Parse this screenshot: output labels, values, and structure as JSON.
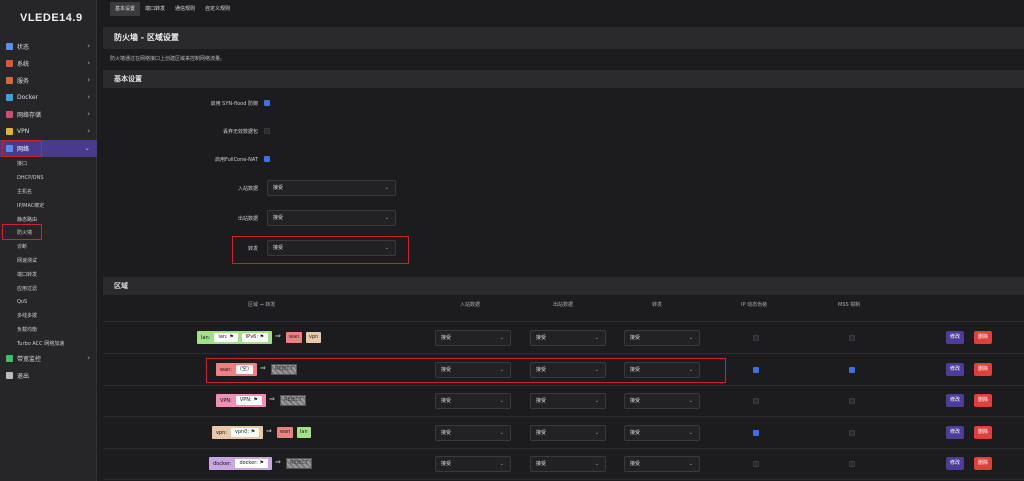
{
  "brand": "VLEDE14.9",
  "menu": [
    {
      "label": "状态",
      "color": "#5b8def"
    },
    {
      "label": "系统",
      "color": "#e0553a"
    },
    {
      "label": "服务",
      "color": "#d46a3a"
    },
    {
      "label": "Docker",
      "color": "#3ba3e0"
    },
    {
      "label": "网络存储",
      "color": "#c8506a"
    },
    {
      "label": "VPN",
      "color": "#e0b23a"
    },
    {
      "label": "网络",
      "color": "#5b8def"
    }
  ],
  "submenu": [
    "接口",
    "DHCP/DNS",
    "主机名",
    "IP/MAC绑定",
    "静态路由",
    "防火墙",
    "诊断",
    "网速测试",
    "端口转发",
    "应用过滤",
    "QoS",
    "多线多拨",
    "负载均衡",
    "Turbo ACC 网络加速"
  ],
  "menu_bottom": [
    {
      "label": "带宽监控",
      "color": "#3fbf6a"
    },
    {
      "label": "退出",
      "color": "#bbb"
    }
  ],
  "tabs": [
    "基本设置",
    "端口转发",
    "通信规则",
    "自定义规则"
  ],
  "title": "防火墙 - 区域设置",
  "description": "防火墙通过在网络接口上创建区域来控制网络流量。",
  "basic": {
    "header": "基本设置",
    "synflood": "启用 SYN-flood 防御",
    "drop_invalid": "丢弃无效数据包",
    "fullcone": "启用FullCone-NAT",
    "input_label": "入站数据",
    "input_value": "接受",
    "output_label": "出站数据",
    "output_value": "接受",
    "forward_label": "转发",
    "forward_value": "接受"
  },
  "zones": {
    "header": "区域",
    "cols": [
      "区域 ⇒ 转发",
      "入站数据",
      "出站数据",
      "转发",
      "IP 动态伪装",
      "MSS 钳制"
    ],
    "rows": [
      {
        "name": "lan:",
        "color": "#a3e089",
        "pills": [
          "lan: ⚑",
          "IPv6: ⚑"
        ],
        "targets": [
          {
            "t": "wan",
            "c": "#f08080"
          },
          {
            "t": "vpn",
            "c": "#e8c8a8"
          }
        ],
        "reject": false,
        "in": "接受",
        "out": "接受",
        "fwd": "接受",
        "masq": false,
        "mss": false
      },
      {
        "name": "wan:",
        "color": "#f08080",
        "pills": [
          "(空)"
        ],
        "targets": [],
        "reject": true,
        "rejtext": "REJECT",
        "in": "接受",
        "out": "接受",
        "fwd": "接受",
        "masq": true,
        "mss": true
      },
      {
        "name": "VPN:",
        "color": "#f090b0",
        "pills": [
          "VPN: ⚑"
        ],
        "targets": [],
        "reject": true,
        "rejtext": "REJECT",
        "in": "接受",
        "out": "接受",
        "fwd": "接受",
        "masq": false,
        "mss": false
      },
      {
        "name": "vpn:",
        "color": "#e8c8a8",
        "pills": [
          "vpn0: ⚑"
        ],
        "targets": [
          {
            "t": "wan",
            "c": "#f08080"
          },
          {
            "t": "lan",
            "c": "#a3e089"
          }
        ],
        "reject": false,
        "in": "接受",
        "out": "接受",
        "fwd": "接受",
        "masq": true,
        "mss": false
      },
      {
        "name": "docker:",
        "color": "#c8a8e0",
        "pills": [
          "docker: ⚑"
        ],
        "targets": [],
        "reject": true,
        "rejtext": "REJECT",
        "in": "接受",
        "out": "接受",
        "fwd": "接受",
        "masq": false,
        "mss": false
      }
    ],
    "edit": "修改",
    "delete": "删除"
  }
}
